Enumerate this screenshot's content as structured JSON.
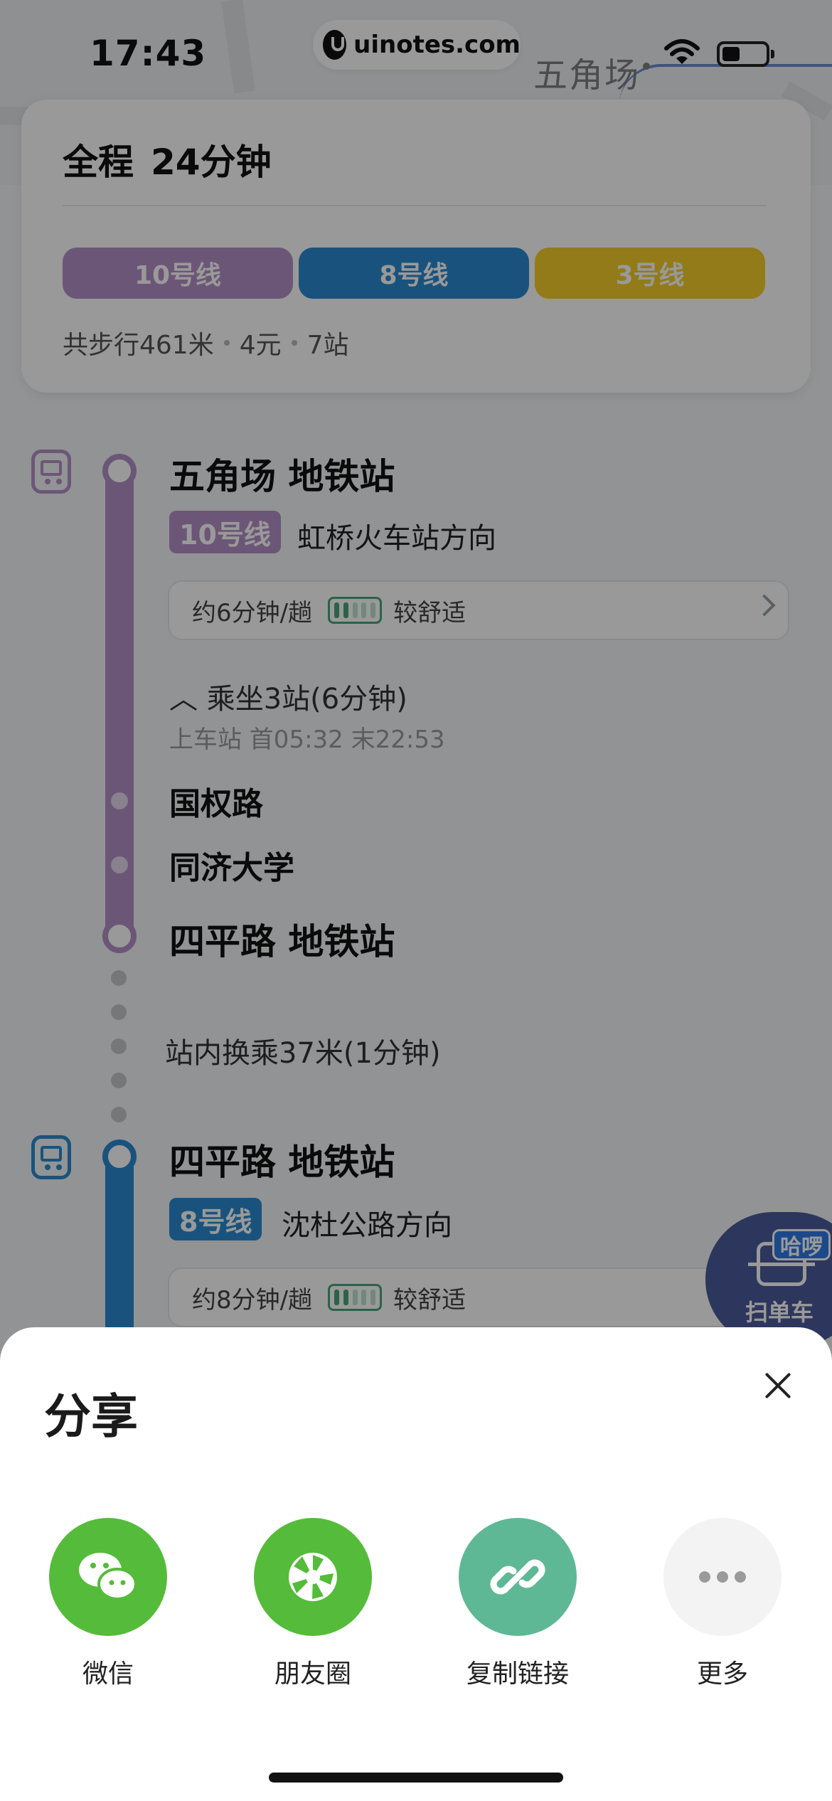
{
  "status_bar": {
    "time": "17:43"
  },
  "watermark": {
    "text": "uinotes.com"
  },
  "map": {
    "place_label": "五角场"
  },
  "summary": {
    "title_prefix": "全程",
    "duration": "24分钟",
    "lines": [
      {
        "label": "10号线",
        "color": "#b48fc6"
      },
      {
        "label": "8号线",
        "color": "#2a8bd0"
      },
      {
        "label": "3号线",
        "color": "#f5cd2b"
      }
    ],
    "walk": "共步行461米",
    "fare": "4元",
    "stops": "7站"
  },
  "segments": [
    {
      "board_station": "五角场 地铁站",
      "line_tag": "10号线",
      "line_color": "#b48fc6",
      "direction": "虹桥火车站方向",
      "frequency": "约6分钟/趟",
      "comfort": "较舒适",
      "ride_info": "︿ 乘坐3站(6分钟)",
      "ride_times": "上车站 首05:32  末22:53",
      "intermediate_stops": [
        "国权路",
        "同济大学"
      ],
      "alight_station": "四平路 地铁站"
    },
    {
      "board_station": "四平路 地铁站",
      "line_tag": "8号线",
      "line_color": "#2a8bd0",
      "direction": "沈杜公路方向",
      "frequency": "约8分钟/趟",
      "comfort": "较舒适"
    }
  ],
  "transfer": {
    "text": "站内换乘37米(1分钟)"
  },
  "scan_button": {
    "badge": "哈啰",
    "label": "扫单车"
  },
  "share": {
    "title": "分享",
    "options": [
      {
        "label": "微信",
        "icon": "wechat-icon",
        "color": "#55bb3a"
      },
      {
        "label": "朋友圈",
        "icon": "moments-icon",
        "color": "#55bb3a"
      },
      {
        "label": "复制链接",
        "icon": "link-icon",
        "color": "#5fb895"
      },
      {
        "label": "更多",
        "icon": "more-icon",
        "color": "#f3f3f3"
      }
    ]
  }
}
